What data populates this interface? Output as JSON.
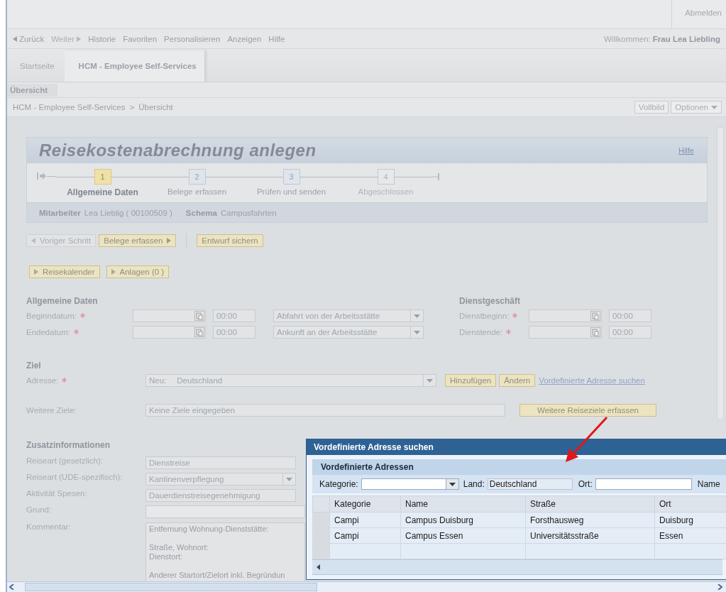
{
  "header": {
    "logout": "Abmelden",
    "nav": [
      {
        "label": "Zurück",
        "disabled": false
      },
      {
        "label": "Weiter",
        "disabled": true
      },
      {
        "label": "Historie",
        "disabled": false
      },
      {
        "label": "Favoriten",
        "disabled": false
      },
      {
        "label": "Personalisieren",
        "disabled": false
      },
      {
        "label": "Anzeigen",
        "disabled": false
      },
      {
        "label": "Hilfe",
        "disabled": false
      }
    ],
    "welcome": {
      "label": "Willkommen:",
      "name": "Frau Lea Liebling"
    }
  },
  "tabs": [
    {
      "label": "Startseite",
      "selected": false
    },
    {
      "label": "HCM - Employee Self-Services",
      "selected": true
    }
  ],
  "subtabs": [
    {
      "label": "Übersicht",
      "selected": true
    }
  ],
  "breadcrumb": {
    "items": [
      "HCM - Employee Self-Services",
      "Übersicht"
    ],
    "separator": ">"
  },
  "page_buttons": [
    {
      "label": "Vollbild",
      "kind": "plain"
    },
    {
      "label": "Optionen",
      "kind": "menu"
    }
  ],
  "form": {
    "title": "Reisekostenabrechnung anlegen",
    "help": "Hilfe",
    "steps": [
      {
        "number": "1",
        "label": "Allgemeine Daten",
        "selected": true,
        "disabled": false
      },
      {
        "number": "2",
        "label": "Belege erfassen",
        "selected": false,
        "disabled": false
      },
      {
        "number": "3",
        "label": "Prüfen und senden",
        "selected": false,
        "disabled": false
      },
      {
        "number": "4",
        "label": "Abgeschlossen",
        "selected": false,
        "disabled": true
      }
    ],
    "info": [
      {
        "label": "Mitarbeiter",
        "value": "Lea Lieblig ( 00100509 )"
      },
      {
        "label": "Schema",
        "value": "Campusfahrten"
      }
    ],
    "step_buttons": [
      {
        "label": "Voriger Schritt",
        "disabled": true
      },
      {
        "label": "Belege erfassen",
        "disabled": false
      },
      {
        "label": "Entwurf sichern",
        "disabled": false
      }
    ],
    "toggles": [
      {
        "label": "Reisekalender"
      },
      {
        "label": "Anlagen (0 )"
      }
    ],
    "general": {
      "heading": "Allgemeine Daten",
      "rows": [
        {
          "label": "Beginndatum:",
          "required": true,
          "time": "00:00",
          "select": "Abfahrt von der Arbeitsstätte"
        },
        {
          "label": "Endedatum:",
          "required": true,
          "time": "00:00",
          "select": "Ankunft an der Arbeitsstätte"
        }
      ]
    },
    "duty": {
      "heading": "Dienstgeschäft",
      "rows": [
        {
          "label": "Dienstbeginn:",
          "required": true,
          "time": "00:00"
        },
        {
          "label": "Dienstende:",
          "required": true,
          "time": "00:00"
        }
      ]
    },
    "goal": {
      "heading": "Ziel",
      "label": "Adresse:",
      "required": true,
      "prefix": "Neu:",
      "value": "Deutschland",
      "buttons": [
        "Hinzufügen",
        "Ändern"
      ],
      "link": "Vordefinierte Adresse suchen",
      "more_label": "Weitere Ziele:",
      "more_value": "Keine Ziele eingegeben",
      "more_button": "Weitere Reiseziele erfassen"
    },
    "extra": {
      "heading": "Zusatzinformationen",
      "rows": [
        {
          "label": "Reiseart (gesetzlich):",
          "kind": "readonly",
          "value": "Dienstreise"
        },
        {
          "label": "Reiseart (UDE-spezifisch):",
          "kind": "select",
          "value": "Kantinenverpflegung"
        },
        {
          "label": "Aktivität Spesen:",
          "kind": "readonly",
          "value": "Dauerdienstreisegenehmigung"
        },
        {
          "label": "Grund:",
          "kind": "input"
        },
        {
          "label": "Kommentar:",
          "kind": "textarea",
          "value": "Entfernung Wohnung-Dienststätte:\n\nStraße, Wohnort:\nDienstort:\n\nAnderer Startort/Zielort inkl. Begründun"
        }
      ]
    }
  },
  "dialog": {
    "title": "Vordefinierte Adresse suchen",
    "panel_title": "Vordefinierte Adressen",
    "filters": [
      {
        "label": "Kategorie:",
        "kind": "select"
      },
      {
        "label": "Land:",
        "kind": "readonly",
        "value": "Deutschland"
      },
      {
        "label": "Ort:",
        "kind": "input"
      },
      {
        "label": "Name",
        "kind": "label"
      }
    ],
    "columns": [
      "Kategorie",
      "Name",
      "Straße",
      "Ort"
    ],
    "rows": [
      [
        "Campi",
        "Campus Duisburg",
        "Forsthausweg",
        "Duisburg"
      ],
      [
        "Campi",
        "Campus Essen",
        "Universitätsstraße",
        "Essen"
      ]
    ]
  }
}
